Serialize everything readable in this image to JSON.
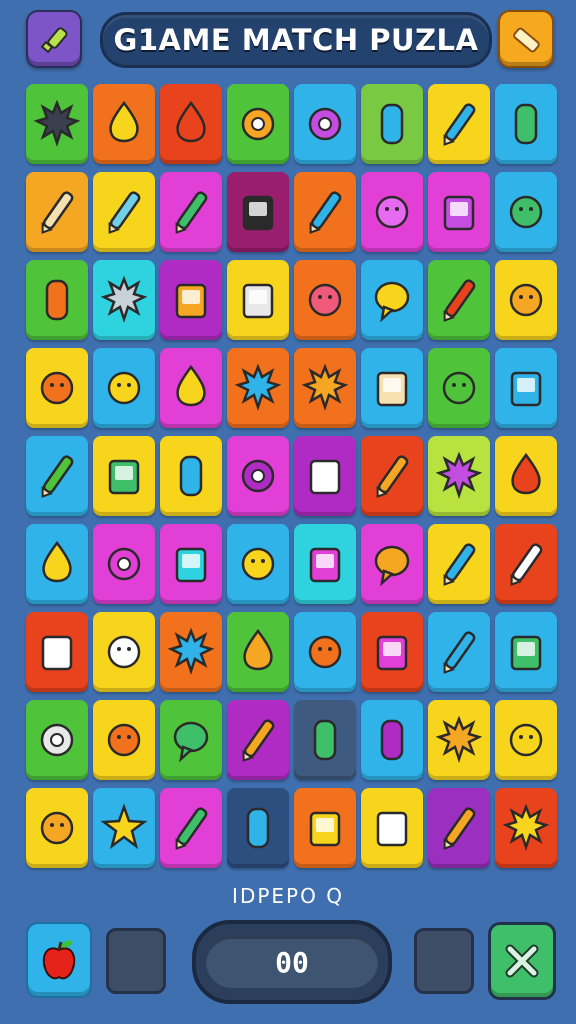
{
  "header": {
    "title": "G1AME MATCH PUZLA",
    "left_button_icon": "key-icon",
    "left_button_color": "#7d55c9",
    "right_button_icon": "eraser-icon",
    "right_button_color": "#f6a91f"
  },
  "board": {
    "rows": [
      [
        {
          "color": "#4fc43a",
          "icon": "funnel-icon"
        },
        {
          "color": "#f2711c",
          "icon": "lemon-icon"
        },
        {
          "color": "#e8431c",
          "icon": "drop-icon"
        },
        {
          "color": "#4fc43a",
          "icon": "tag-icon"
        },
        {
          "color": "#2fb3e8",
          "icon": "button-icon"
        },
        {
          "color": "#7ac943",
          "icon": "bottle-icon"
        },
        {
          "color": "#f7d51d",
          "icon": "capsule-icon"
        },
        {
          "color": "#2fb3e8",
          "icon": "cup-icon"
        }
      ],
      [
        {
          "color": "#f5a623",
          "icon": "scissors-icon"
        },
        {
          "color": "#f7d51d",
          "icon": "pill-icon"
        },
        {
          "color": "#e23fd6",
          "icon": "marker-icon"
        },
        {
          "color": "#9a1e6e",
          "icon": "phone-icon"
        },
        {
          "color": "#f2711c",
          "icon": "pencil-icon"
        },
        {
          "color": "#e23fd6",
          "icon": "blob-face-icon"
        },
        {
          "color": "#e23fd6",
          "icon": "shirt-icon"
        },
        {
          "color": "#2fb3e8",
          "icon": "melon-icon"
        }
      ],
      [
        {
          "color": "#4fc43a",
          "icon": "jar-icon"
        },
        {
          "color": "#2fd3e0",
          "icon": "gear-face-icon"
        },
        {
          "color": "#b02bc4",
          "icon": "box-icon"
        },
        {
          "color": "#f7d51d",
          "icon": "battery-icon"
        },
        {
          "color": "#f2711c",
          "icon": "ghost-icon"
        },
        {
          "color": "#2fb3e8",
          "icon": "bubble-icon"
        },
        {
          "color": "#4fc43a",
          "icon": "pen-icon"
        },
        {
          "color": "#f7d51d",
          "icon": "smiley-icon"
        }
      ],
      [
        {
          "color": "#f7d51d",
          "icon": "monster-icon"
        },
        {
          "color": "#2fb3e8",
          "icon": "cat-icon"
        },
        {
          "color": "#e23fd6",
          "icon": "pepper-icon"
        },
        {
          "color": "#f2711c",
          "icon": "star-burst-icon"
        },
        {
          "color": "#f2711c",
          "icon": "bird-icon"
        },
        {
          "color": "#2fb3e8",
          "icon": "house-icon"
        },
        {
          "color": "#4fc43a",
          "icon": "alien-icon"
        },
        {
          "color": "#2fb3e8",
          "icon": "tablet-icon"
        }
      ],
      [
        {
          "color": "#2fb3e8",
          "icon": "brush-icon"
        },
        {
          "color": "#f7d51d",
          "icon": "check-card-icon"
        },
        {
          "color": "#f7d51d",
          "icon": "vest-icon"
        },
        {
          "color": "#e23fd6",
          "icon": "ring-icon"
        },
        {
          "color": "#b02bc4",
          "icon": "bag-icon"
        },
        {
          "color": "#e8431c",
          "icon": "crayon-icon"
        },
        {
          "color": "#b8e23f",
          "icon": "splat-icon"
        },
        {
          "color": "#f7d51d",
          "icon": "strawberry-icon"
        }
      ],
      [
        {
          "color": "#2fb3e8",
          "icon": "acorn-icon"
        },
        {
          "color": "#e23fd6",
          "icon": "letter-r-icon"
        },
        {
          "color": "#e23fd6",
          "icon": "frame-icon"
        },
        {
          "color": "#2fb3e8",
          "icon": "chick-icon"
        },
        {
          "color": "#2fd3e0",
          "icon": "card-icon"
        },
        {
          "color": "#e23fd6",
          "icon": "bow-icon"
        },
        {
          "color": "#f7d51d",
          "icon": "popsicle-icon"
        },
        {
          "color": "#e8431c",
          "icon": "glue-icon"
        }
      ],
      [
        {
          "color": "#e8431c",
          "icon": "basket-icon"
        },
        {
          "color": "#f7d51d",
          "icon": "clown-icon"
        },
        {
          "color": "#f2711c",
          "icon": "virus-icon"
        },
        {
          "color": "#4fc43a",
          "icon": "fish-icon"
        },
        {
          "color": "#2fb3e8",
          "icon": "pumpkin-icon"
        },
        {
          "color": "#e8431c",
          "icon": "mirror-icon"
        },
        {
          "color": "#2fb3e8",
          "icon": "pencil-icon"
        },
        {
          "color": "#2fb3e8",
          "icon": "play-tablet-icon"
        }
      ],
      [
        {
          "color": "#4fc43a",
          "icon": "robot-eye-icon"
        },
        {
          "color": "#f7d51d",
          "icon": "devil-icon"
        },
        {
          "color": "#4fc43a",
          "icon": "speech-icon"
        },
        {
          "color": "#b02bc4",
          "icon": "crayon-icon"
        },
        {
          "color": "#3e5a7e",
          "icon": "cup-icon"
        },
        {
          "color": "#2fb3e8",
          "icon": "potion-icon"
        },
        {
          "color": "#f7d51d",
          "icon": "sun-face-icon"
        },
        {
          "color": "#f7d51d",
          "icon": "mask-icon"
        }
      ],
      [
        {
          "color": "#f7d51d",
          "icon": "crab-icon"
        },
        {
          "color": "#2fb3e8",
          "icon": "star-icon"
        },
        {
          "color": "#e23fd6",
          "icon": "marker-icon"
        },
        {
          "color": "#2c4f80",
          "icon": "glass-icon"
        },
        {
          "color": "#f2711c",
          "icon": "carton-icon"
        },
        {
          "color": "#f7d51d",
          "icon": "paper-icon"
        },
        {
          "color": "#9b2fc0",
          "icon": "crayon-icon"
        },
        {
          "color": "#e8431c",
          "icon": "gear-icon"
        }
      ]
    ]
  },
  "status_text": "IDPEPO  Q",
  "footer": {
    "left_icon": "apple-icon",
    "score": "00",
    "right_icon": "close-icon",
    "close_color": "#3fbf6a"
  }
}
